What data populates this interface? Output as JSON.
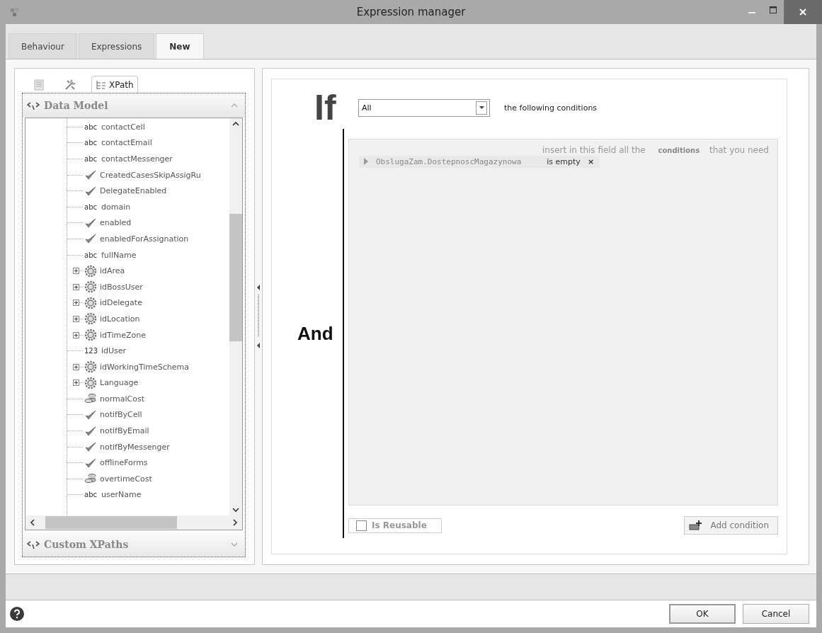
{
  "window": {
    "title": "Expression manager"
  },
  "tabs": [
    {
      "label": "Behaviour",
      "selected": false
    },
    {
      "label": "Expressions",
      "selected": false
    },
    {
      "label": "New",
      "selected": true
    }
  ],
  "tool_tabs": [
    {
      "kind": "document",
      "selected": false
    },
    {
      "kind": "tools",
      "selected": false
    },
    {
      "kind": "tree",
      "label": "XPath",
      "selected": true
    }
  ],
  "data_model": {
    "title": "Data Model",
    "expanded": true,
    "items": [
      {
        "kind": "text",
        "type_label": "abc",
        "label": "contactCell"
      },
      {
        "kind": "text",
        "type_label": "abc",
        "label": "contactEmail"
      },
      {
        "kind": "text",
        "type_label": "abc",
        "label": "contactMessenger"
      },
      {
        "kind": "bool",
        "label": "CreatedCasesSkipAssigRu"
      },
      {
        "kind": "bool",
        "label": "DelegateEnabled"
      },
      {
        "kind": "text",
        "type_label": "abc",
        "label": "domain"
      },
      {
        "kind": "bool",
        "label": "enabled"
      },
      {
        "kind": "bool",
        "label": "enabledForAssignation"
      },
      {
        "kind": "text",
        "type_label": "abc",
        "label": "fullName"
      },
      {
        "kind": "entity",
        "label": "idArea",
        "expanded": false
      },
      {
        "kind": "entity",
        "label": "idBossUser",
        "expanded": false
      },
      {
        "kind": "entity",
        "label": "idDelegate",
        "expanded": false
      },
      {
        "kind": "entity",
        "label": "idLocation",
        "expanded": false
      },
      {
        "kind": "entity",
        "label": "idTimeZone",
        "expanded": false
      },
      {
        "kind": "number",
        "type_label": "123",
        "label": "idUser"
      },
      {
        "kind": "entity",
        "label": "idWorkingTimeSchema",
        "expanded": false
      },
      {
        "kind": "entity",
        "label": "Language",
        "expanded": false
      },
      {
        "kind": "money",
        "label": "normalCost"
      },
      {
        "kind": "bool",
        "label": "notifByCell"
      },
      {
        "kind": "bool",
        "label": "notifByEmail"
      },
      {
        "kind": "bool",
        "label": "notifByMessenger"
      },
      {
        "kind": "bool",
        "label": "offlineForms"
      },
      {
        "kind": "money",
        "label": "overtimeCost"
      },
      {
        "kind": "text",
        "type_label": "abc",
        "label": "userName"
      }
    ]
  },
  "custom_xpaths": {
    "title": "Custom XPaths",
    "expanded": false
  },
  "expression": {
    "if_word": "If",
    "match": "All",
    "match_suffix": "the following conditions",
    "and_word": "And",
    "hint": "insert in this field all the **conditions** that you need",
    "conditions": [
      {
        "field": "ObslugaZam.DostepnoscMagazynowa",
        "operator": "is empty",
        "remove": "×"
      }
    ],
    "reusable": {
      "label": "Is Reusable",
      "checked": false
    },
    "add_button": "Add condition"
  },
  "buttons": [
    "OK",
    "Cancel"
  ]
}
